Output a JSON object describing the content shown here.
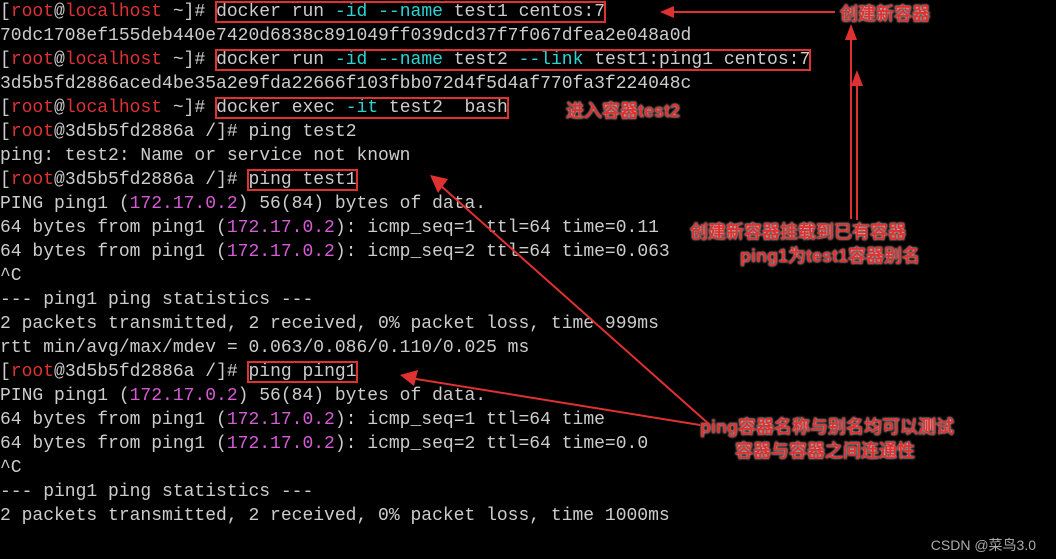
{
  "prompts": {
    "root_user": "root",
    "at": "@",
    "host_local": "localhost",
    "host_cont": "3d5b5fd2886a",
    "tail_home": " ~]# ",
    "tail_root": " /]# "
  },
  "cmd": {
    "docker": "docker ",
    "run": "run ",
    "exec": "exec ",
    "flag_id": "-id",
    "flag_it": "-it",
    "flag_name": " --name",
    "flag_link": "--link",
    "test1": " test1 ",
    "test2": " test2 ",
    "centos7": "centos:7",
    "link_arg": " test1:ping1 ",
    "bash": " bash",
    "ping_test2": "ping test2",
    "ping_test1": "ping test1",
    "ping_ping1": "ping ping1"
  },
  "out": {
    "hash1": "70dc1708ef155deb440e7420d6838c891049ff039dcd37f7f067dfea2e048a0d",
    "hash2": "3d5b5fd2886aced4be35a2e9fda22666f103fbb072d4f5d4af770fa3f224048c",
    "ping_err": "ping: test2: Name or service not known",
    "ping_hdr_test1": "PING ping1 (",
    "ping_ip": "172.17.0.2",
    "ping_hdr_tail": ") 56(84) bytes of data.",
    "p64_pre": "64 bytes from ping1 (",
    "p64_mid1": "): icmp_seq=1 ttl=64 time=0.11",
    "p64_mid2": "): icmp_seq=2 ttl=64 time=0.063 ",
    "p64b_mid1": "): icmp_seq=1 ttl=64 time",
    "p64b_mid2": "): icmp_seq=2 ttl=64 time=0.0",
    "ctrlc": "^C",
    "stats_hdr": "--- ping1 ping statistics ---",
    "stats_line1": "2 packets transmitted, 2 received, 0% packet loss, time 999ms",
    "stats_line2": "rtt min/avg/max/mdev = 0.063/0.086/0.110/0.025 ms",
    "stats_line1b": "2 packets transmitted, 2 received, 0% packet loss, time 1000ms"
  },
  "anno": {
    "a1": "创建新容器",
    "a2": "进入容器test2",
    "a3a": "创建新容器挂载到已有容器",
    "a3b": "ping1为test1容器别名",
    "a4a": "ping容器名称与别名均可以测试",
    "a4b": "容器与容器之间连通性"
  },
  "watermark": "CSDN @菜鸟3.0"
}
